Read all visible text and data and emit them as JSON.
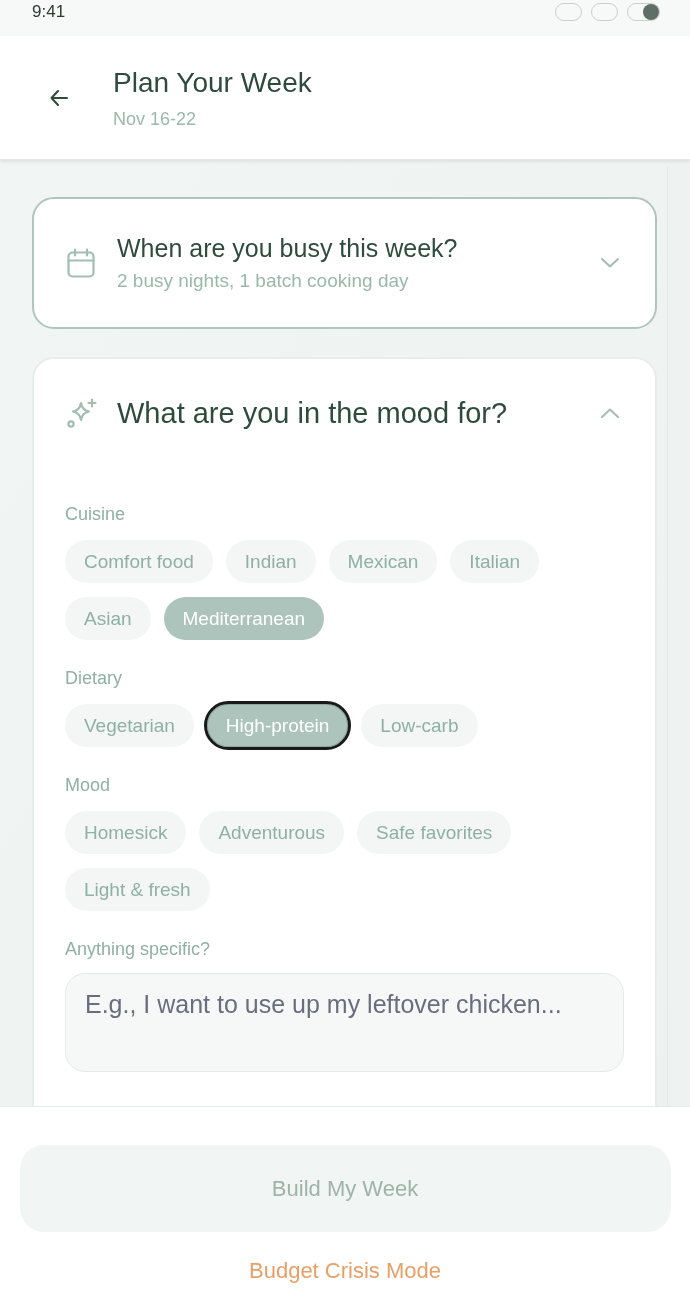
{
  "status_bar": {
    "time": "9:41"
  },
  "header": {
    "title": "Plan Your Week",
    "subtitle": "Nov 16-22"
  },
  "sections": [
    {
      "kind": "calendar",
      "title": "When are you busy this week?",
      "summary": "2 busy nights, 1 batch cooking day",
      "highlighted": true,
      "expanded": false
    },
    {
      "kind": "sparkle",
      "title": "What are you in the mood for?",
      "highlighted": false,
      "expanded": true,
      "groups": [
        {
          "label": "Cuisine",
          "options": [
            {
              "label": "Comfort food",
              "selected": false,
              "focused": false
            },
            {
              "label": "Indian",
              "selected": false,
              "focused": false
            },
            {
              "label": "Mexican",
              "selected": false,
              "focused": false
            },
            {
              "label": "Italian",
              "selected": false,
              "focused": false
            },
            {
              "label": "Asian",
              "selected": false,
              "focused": false
            },
            {
              "label": "Mediterranean",
              "selected": true,
              "focused": false
            }
          ]
        },
        {
          "label": "Dietary",
          "options": [
            {
              "label": "Vegetarian",
              "selected": false,
              "focused": false
            },
            {
              "label": "High-protein",
              "selected": true,
              "focused": true
            },
            {
              "label": "Low-carb",
              "selected": false,
              "focused": false
            }
          ]
        },
        {
          "label": "Mood",
          "options": [
            {
              "label": "Homesick",
              "selected": false,
              "focused": false
            },
            {
              "label": "Adventurous",
              "selected": false,
              "focused": false
            },
            {
              "label": "Safe favorites",
              "selected": false,
              "focused": false
            },
            {
              "label": "Light & fresh",
              "selected": false,
              "focused": false
            }
          ]
        }
      ],
      "notes": {
        "label": "Anything specific?",
        "placeholder": "E.g., I want to use up my leftover chicken..."
      }
    }
  ],
  "actions": {
    "primary": {
      "label": "Build My Week",
      "disabled": true
    },
    "link": {
      "label": "Budget Crisis Mode"
    }
  }
}
